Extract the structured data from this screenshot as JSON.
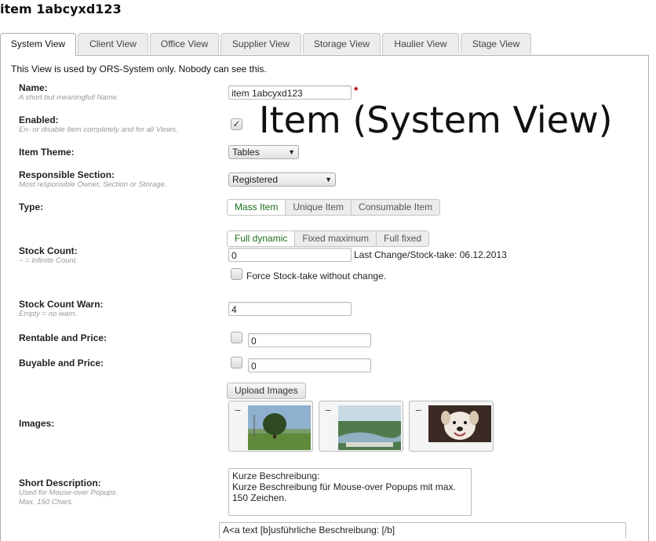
{
  "page": {
    "title": "item 1abcyxd123",
    "overlay_title": "Item (System View)"
  },
  "tabs": [
    {
      "label": "System View",
      "active": true
    },
    {
      "label": "Client View"
    },
    {
      "label": "Office View"
    },
    {
      "label": "Supplier View"
    },
    {
      "label": "Storage View"
    },
    {
      "label": "Haulier View"
    },
    {
      "label": "Stage View"
    }
  ],
  "intro": "This View is used by ORS-System only. Nobody can see this.",
  "fields": {
    "name": {
      "label": "Name:",
      "hint": "A short but meaningfull Name.",
      "value": "item 1abcyxd123",
      "required_mark": "*"
    },
    "enabled": {
      "label": "Enabled:",
      "hint": "En- or disable Item completely and for all Views.",
      "checked": true,
      "check_glyph": "✓"
    },
    "item_theme": {
      "label": "Item Theme:",
      "value": "Tables"
    },
    "responsible_section": {
      "label": "Responsible Section:",
      "hint": "Most responsible Owner, Section or Storage.",
      "value": "Registered"
    },
    "type": {
      "label": "Type:",
      "options": [
        "Mass Item",
        "Unique Item",
        "Consumable Item"
      ],
      "selected": "Mass Item"
    },
    "stock_count": {
      "label": "Stock Count:",
      "hint": "~ = Infinite Count.",
      "modes": [
        "Full dynamic",
        "Fixed maximum",
        "Full fixed"
      ],
      "selected_mode": "Full dynamic",
      "value": "0",
      "last_change": "Last Change/Stock-take: 06.12.2013",
      "force_label": "Force Stock-take without change."
    },
    "stock_count_warn": {
      "label": "Stock Count Warn:",
      "hint": "Empty = no warn.",
      "value": "4"
    },
    "rentable": {
      "label": "Rentable and Price:",
      "value": "0"
    },
    "buyable": {
      "label": "Buyable and Price:",
      "value": "0"
    },
    "images": {
      "label": "Images:",
      "upload_label": "Upload Images",
      "remove_glyph": "−",
      "items": [
        "tree-field-photo",
        "river-valley-photo",
        "dog-photo"
      ]
    },
    "short_description": {
      "label": "Short Description:",
      "hint_1": "Used for Mouse-over Popups.",
      "hint_2": "Max. 150 Chars.",
      "line_1": "Kurze Beschreibung:",
      "line_2": "Kurze Beschreibung für Mouse-over Popups mit max.",
      "line_3": "150 Zeichen."
    },
    "long_description": {
      "line_1": "A<a text [b]usführliche Beschreibung: [/b]"
    }
  },
  "colors": {
    "active_toggle_text": "#1b6e1b",
    "required": "#aa0000"
  }
}
